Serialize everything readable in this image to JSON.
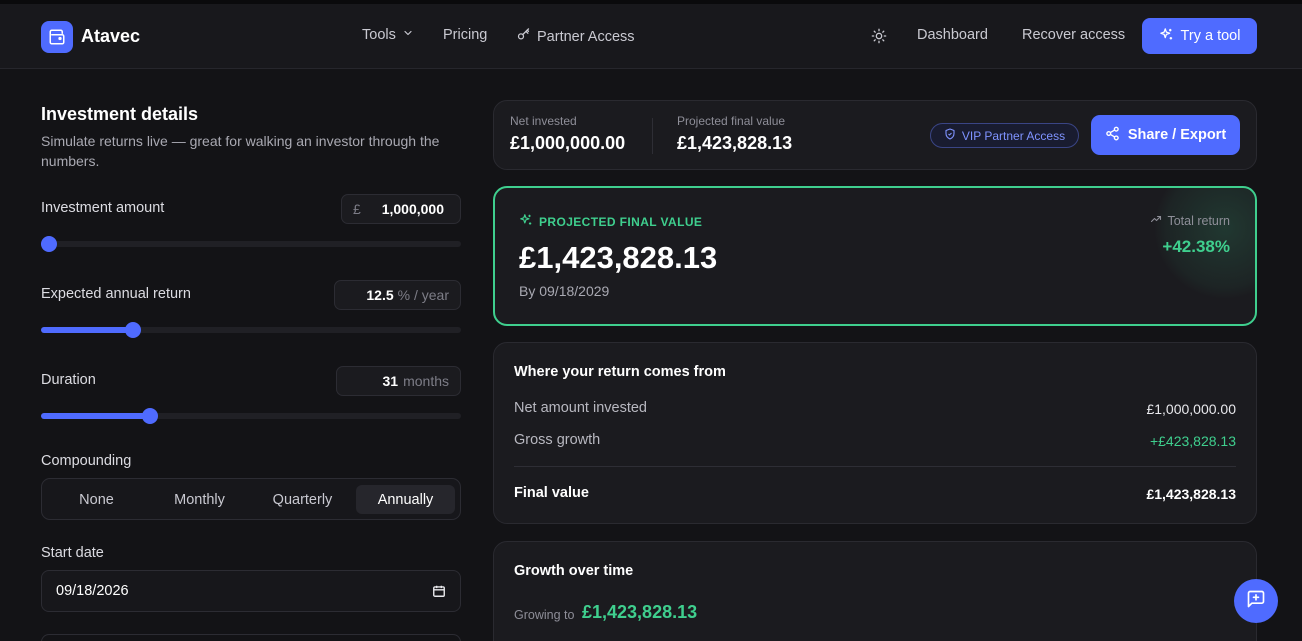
{
  "header": {
    "brand": "Atavec",
    "nav": [
      {
        "label": "Tools"
      },
      {
        "label": "Pricing"
      },
      {
        "label": "Partner Access"
      }
    ],
    "right": [
      {
        "label": "Dashboard"
      },
      {
        "label": "Recover access"
      }
    ],
    "cta": "Try a tool"
  },
  "form": {
    "title": "Investment details",
    "description": "Simulate returns live — great for walking an investor through the numbers.",
    "amount": {
      "label": "Investment amount",
      "prefix": "£",
      "value": "1,000,000",
      "slider_fraction": 0.02
    },
    "annual_return": {
      "label": "Expected annual return",
      "value": "12.5",
      "unit": "% / year",
      "slider_fraction": 0.22
    },
    "duration": {
      "label": "Duration",
      "value": "31",
      "unit": "months",
      "slider_fraction": 0.26
    },
    "compounding": {
      "label": "Compounding",
      "options": [
        "None",
        "Monthly",
        "Quarterly",
        "Annually"
      ],
      "selected": "Annually"
    },
    "start_date": {
      "label": "Start date",
      "value": "09/18/2026"
    }
  },
  "summary": {
    "net_invested_label": "Net invested",
    "net_invested_value": "£1,000,000.00",
    "projected_label": "Projected final value",
    "projected_value": "£1,423,828.13",
    "vip_badge": "VIP Partner Access",
    "share_label": "Share / Export"
  },
  "projection": {
    "tag": "PROJECTED FINAL VALUE",
    "value": "£1,423,828.13",
    "by_date": "By 09/18/2029",
    "total_return_label": "Total return",
    "total_return_value": "+42.38%"
  },
  "breakdown": {
    "title": "Where your return comes from",
    "rows": [
      {
        "label": "Net amount invested",
        "value": "£1,000,000.00"
      },
      {
        "label": "Gross growth",
        "value": "+£423,828.13"
      }
    ],
    "final_label": "Final value",
    "final_value": "£1,423,828.13"
  },
  "growth": {
    "title": "Growth over time",
    "growing_label": "Growing to",
    "growing_value": "£1,423,828.13"
  },
  "colors": {
    "accent": "#4f6bff",
    "positive": "#3fcf8e",
    "background": "#131316",
    "card": "#1b1b1f"
  },
  "icons": {
    "logo": "wallet-icon",
    "tools_chevron": "chevron-down-icon",
    "partner": "key-icon",
    "theme": "sun-icon",
    "cta": "sparkles-icon",
    "vip": "shield-icon",
    "share": "share-icon",
    "total_return": "trending-up-icon",
    "calendar": "calendar-icon",
    "fab": "message-plus-icon"
  }
}
